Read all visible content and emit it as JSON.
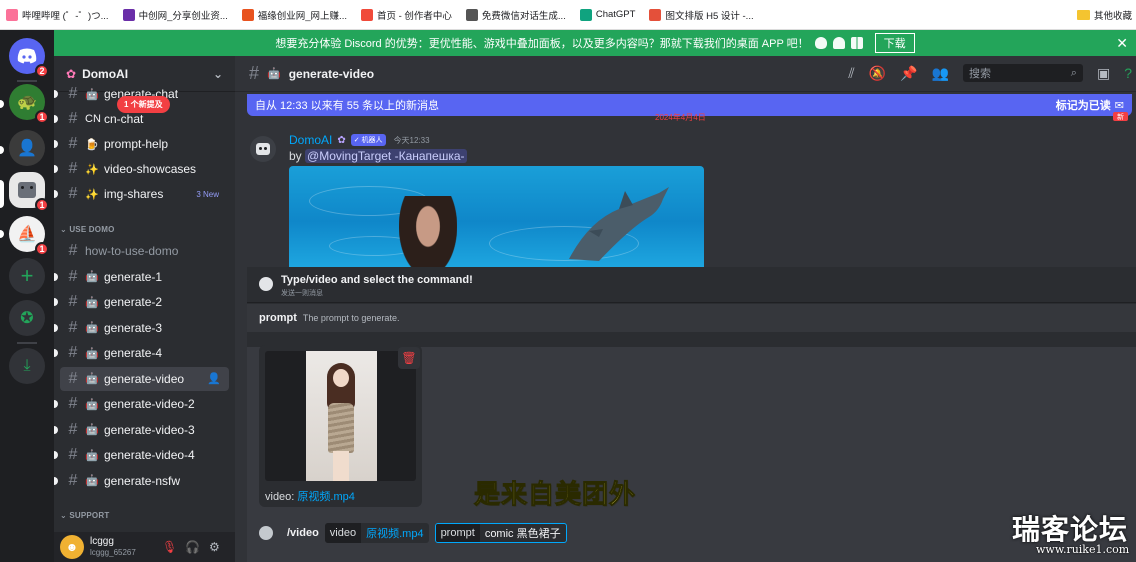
{
  "bookmarks": [
    {
      "label": "哔哩哔哩 (゜-゜)つ...",
      "color": "#fb7299"
    },
    {
      "label": "中创网_分享创业资...",
      "color": "#6a2ea8"
    },
    {
      "label": "福缘创业网_网上赚...",
      "color": "#e8531f"
    },
    {
      "label": "首页 - 创作者中心",
      "color": "#f04a3a"
    },
    {
      "label": "免费微信对话生成...",
      "color": "#555555"
    },
    {
      "label": "ChatGPT",
      "color": "#10a37f"
    },
    {
      "label": "图文排版 H5 设计 -...",
      "color": "#e4503a"
    }
  ],
  "bookmarks_other": "其他收藏",
  "banner": {
    "text": "想要充分体验 Discord 的优势：更优性能、游戏中叠加面板，以及更多内容吗？那就下载我们的桌面 APP 吧！",
    "download": "下载",
    "close": "✕"
  },
  "rail": {
    "badges": [
      "2",
      "1",
      "1",
      "1"
    ]
  },
  "guild": {
    "name": "DomoAI"
  },
  "new_mentions_pill": "1 个新提及",
  "channels": [
    {
      "name": "generate-chat",
      "emoji": "🤖",
      "unread": true
    },
    {
      "name": "cn-chat",
      "emoji": "CN",
      "unread": true
    },
    {
      "name": "prompt-help",
      "emoji": "🍺",
      "unread": true
    },
    {
      "name": "video-showcases",
      "emoji": "✨",
      "unread": true
    },
    {
      "name": "img-shares",
      "emoji": "✨",
      "unread": true,
      "new": "3 New"
    }
  ],
  "category_use": "USE DOMO",
  "use_channels": [
    {
      "name": "how-to-use-domo",
      "emoji": "",
      "unread": false
    },
    {
      "name": "generate-1",
      "emoji": "🤖",
      "unread": true
    },
    {
      "name": "generate-2",
      "emoji": "🤖",
      "unread": true
    },
    {
      "name": "generate-3",
      "emoji": "🤖",
      "unread": true
    },
    {
      "name": "generate-4",
      "emoji": "🤖",
      "unread": true
    },
    {
      "name": "generate-video",
      "emoji": "🤖",
      "unread": true,
      "active": true
    },
    {
      "name": "generate-video-2",
      "emoji": "🤖",
      "unread": true
    },
    {
      "name": "generate-video-3",
      "emoji": "🤖",
      "unread": true
    },
    {
      "name": "generate-video-4",
      "emoji": "🤖",
      "unread": true
    },
    {
      "name": "generate-nsfw",
      "emoji": "🤖",
      "unread": true
    }
  ],
  "category_support": "SUPPORT",
  "user": {
    "name": "lcggg",
    "tag": "lcggg_65267"
  },
  "chat": {
    "channel": "generate-video",
    "search_placeholder": "搜索"
  },
  "newbar": {
    "text": "自从 12:33 以来有 55 条以上的新消息",
    "mark": "标记为已读"
  },
  "date_sep": "2024年4月4日",
  "new_label": "新",
  "message": {
    "author": "DomoAI",
    "bot_tag": "✓ 机器人",
    "time": "今天12:33",
    "by_prefix": "by",
    "mention": "@MovingTarget -Канапешка-"
  },
  "command": {
    "title": "Type/video and select the command!",
    "subtitle": "发送一则消息",
    "arg_name": "prompt",
    "arg_desc": "The prompt to generate."
  },
  "attachment": {
    "label_prefix": "video:",
    "filename": "原视频.mp4"
  },
  "subtitle_overlay": "是来自美团外",
  "input": {
    "slash": "/video",
    "opt1_key": "video",
    "opt1_val": "原视频.mp4",
    "opt2_key": "prompt",
    "opt2_val": "comic  黑色裙子"
  },
  "watermark": {
    "text": "瑞客论坛",
    "url": "www.ruike1.com"
  }
}
